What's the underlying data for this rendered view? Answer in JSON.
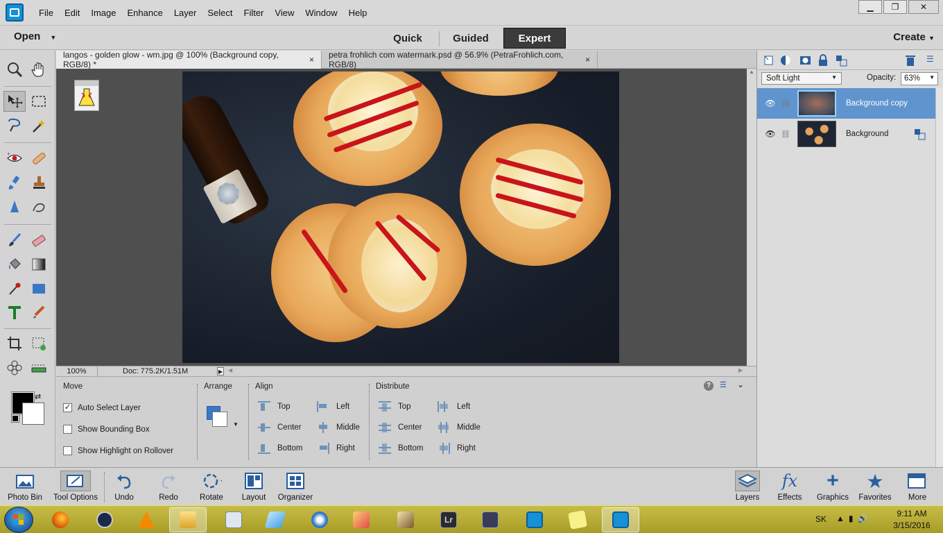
{
  "menu": [
    "File",
    "Edit",
    "Image",
    "Enhance",
    "Layer",
    "Select",
    "Filter",
    "View",
    "Window",
    "Help"
  ],
  "modebar": {
    "open_label": "Open",
    "modes": [
      "Quick",
      "Guided",
      "Expert"
    ],
    "active_mode": "Expert",
    "create_label": "Create"
  },
  "documents": [
    {
      "title": "langos - golden glow - wm.jpg @ 100% (Background copy, RGB/8) *",
      "close": "×",
      "active": true
    },
    {
      "title": "petra frohlich com watermark.psd @ 56.9% (PetraFrohlich.com, RGB/8)",
      "close": "×",
      "active": false
    }
  ],
  "status": {
    "zoom": "100%",
    "doc_size": "Doc: 775.2K/1.51M"
  },
  "tool_options": {
    "move_title": "Move",
    "checkboxes": [
      {
        "label": "Auto Select Layer",
        "checked": true,
        "mark": "✓"
      },
      {
        "label": "Show Bounding Box",
        "checked": false,
        "mark": ""
      },
      {
        "label": "Show Highlight on Rollover",
        "checked": false,
        "mark": ""
      }
    ],
    "arrange_title": "Arrange",
    "align_title": "Align",
    "align": {
      "col1": [
        "Top",
        "Center",
        "Bottom"
      ],
      "col2": [
        "Left",
        "Middle",
        "Right"
      ]
    },
    "distribute_title": "Distribute",
    "distribute": {
      "col1": [
        "Top",
        "Center",
        "Bottom"
      ],
      "col2": [
        "Left",
        "Middle",
        "Right"
      ]
    }
  },
  "layers_panel": {
    "blend_mode": "Soft Light",
    "opacity_label": "Opacity:",
    "opacity_value": "63%",
    "layers": [
      {
        "name": "Background copy",
        "selected": true
      },
      {
        "name": "Background",
        "selected": false
      }
    ]
  },
  "bottom_bar": {
    "left": [
      "Photo Bin",
      "Tool Options",
      "Undo",
      "Redo",
      "Rotate",
      "Layout",
      "Organizer"
    ],
    "right": [
      "Layers",
      "Effects",
      "Graphics",
      "Favorites",
      "More"
    ]
  },
  "taskbar": {
    "lang": "SK",
    "time": "9:11 AM",
    "date": "3/15/2016"
  },
  "colors": {
    "accent": "#5f94cf",
    "expert_tab": "#3b3b3b",
    "canvas_bg": "#4f4f4f"
  }
}
